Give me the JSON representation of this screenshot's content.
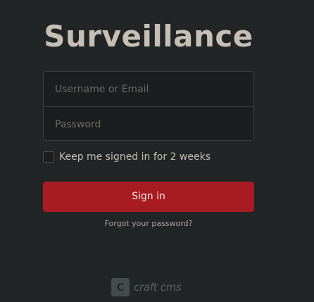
{
  "site": {
    "title": "Surveillance"
  },
  "form": {
    "username_placeholder": "Username or Email",
    "password_placeholder": "Password",
    "remember_label": "Keep me signed in for 2 weeks",
    "remember_checked": false,
    "submit_label": "Sign in",
    "forgot_label": "Forgot your password?"
  },
  "footer": {
    "brand_icon_letter": "C",
    "brand_text": "craft cms"
  },
  "colors": {
    "background": "#222526",
    "accent": "#a91b23",
    "title": "#c5bfb5"
  }
}
